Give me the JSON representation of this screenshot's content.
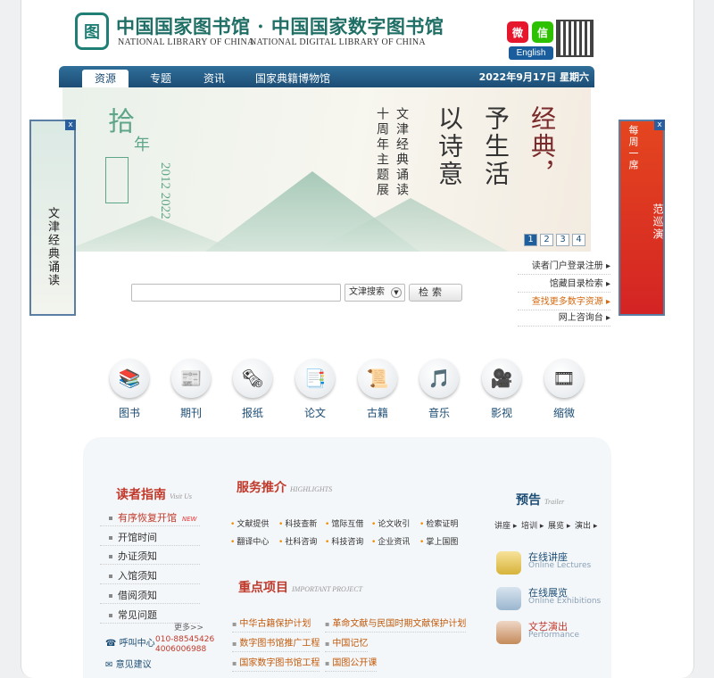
{
  "header": {
    "logo_char": "图",
    "title_cn": "中国国家图书馆 · 中国国家数字图书馆",
    "title_en_left": "NATIONAL LIBRARY OF CHINA",
    "title_en_right": "NATIONAL DIGITAL LIBRARY OF CHINA",
    "weibo_icon": "weibo-icon",
    "wechat_icon": "wechat-icon",
    "english_label": "English"
  },
  "nav": {
    "tabs": [
      {
        "label": "资源",
        "active": true
      },
      {
        "label": "专题",
        "active": false
      },
      {
        "label": "资讯",
        "active": false
      },
      {
        "label": "国家典籍博物馆",
        "active": false
      }
    ],
    "date": "2022年9月17日 星期六"
  },
  "banner": {
    "shi": "拾",
    "nian": "年",
    "year": "2012 2022",
    "col1": "经典，",
    "col2": "予生活",
    "col3": "以诗意",
    "col4": "文津经典诵读",
    "col5": "十周年主题展",
    "pages": [
      "1",
      "2",
      "3",
      "4"
    ]
  },
  "ads": {
    "left_text": "文津经典诵读",
    "right_text": "第一届全国道德模范巡演",
    "right_top": "每周一席",
    "close_label": "x"
  },
  "search": {
    "placeholder": "",
    "scope": "文津搜索",
    "button": "检索"
  },
  "quick_links": [
    {
      "label": "读者门户登录注册 ▸",
      "highlight": false
    },
    {
      "label": "馆藏目录检索 ▸",
      "highlight": false
    },
    {
      "label": "查找更多数字资源 ▸",
      "highlight": true
    },
    {
      "label": "网上咨询台 ▸",
      "highlight": false
    }
  ],
  "categories": [
    {
      "label": "图书",
      "icon": "books-icon",
      "glyph": "📚"
    },
    {
      "label": "期刊",
      "icon": "journal-icon",
      "glyph": "📰"
    },
    {
      "label": "报纸",
      "icon": "newspaper-icon",
      "glyph": "🗞"
    },
    {
      "label": "论文",
      "icon": "thesis-icon",
      "glyph": "📑"
    },
    {
      "label": "古籍",
      "icon": "ancient-scroll-icon",
      "glyph": "📜"
    },
    {
      "label": "音乐",
      "icon": "music-icon",
      "glyph": "🎵"
    },
    {
      "label": "影视",
      "icon": "film-projector-icon",
      "glyph": "🎥"
    },
    {
      "label": "缩微",
      "icon": "microfilm-icon",
      "glyph": "🎞"
    }
  ],
  "guide": {
    "title": "读者指南",
    "title_en": "Visit Us",
    "items": [
      {
        "label": "有序恢复开馆",
        "highlight": true,
        "badge": "NEW"
      },
      {
        "label": "开馆时间",
        "highlight": false,
        "badge": ""
      },
      {
        "label": "办证须知",
        "highlight": false,
        "badge": ""
      },
      {
        "label": "入馆须知",
        "highlight": false,
        "badge": ""
      },
      {
        "label": "借阅须知",
        "highlight": false,
        "badge": ""
      },
      {
        "label": "常见问题",
        "highlight": false,
        "badge": ""
      }
    ],
    "more": "更多>>",
    "hotline_label": "呼叫中心",
    "hotline_numbers": "010-88545426\n4006006988",
    "feedback": "意见建议"
  },
  "services": {
    "title": "服务推介",
    "title_en": "HIGHLIGHTS",
    "row1": [
      "文献提供",
      "科技查新",
      "馆际互借",
      "论文收引",
      "检索证明"
    ],
    "row2": [
      "翻译中心",
      "社科咨询",
      "科技咨询",
      "企业资讯",
      "掌上国图"
    ]
  },
  "projects": {
    "title": "重点项目",
    "title_en": "IMPORTANT PROJECT",
    "items": [
      "中华古籍保护计划",
      "革命文献与民国时期文献保护计划",
      "数字图书馆推广工程",
      "中国记忆",
      "国家数字图书馆工程",
      "国图公开课"
    ]
  },
  "trailer": {
    "title": "预告",
    "title_en": "Trailer",
    "links": [
      "讲座 ▸",
      "培训 ▸",
      "展览 ▸",
      "演出 ▸"
    ],
    "items": [
      {
        "cn": "在线讲座",
        "en": "Online Lectures",
        "icon": "podium-icon"
      },
      {
        "cn": "在线展览",
        "en": "Online Exhibitions",
        "icon": "monitor-icon"
      },
      {
        "cn": "文艺演出",
        "en": "Performance",
        "icon": "theater-icon"
      }
    ]
  }
}
